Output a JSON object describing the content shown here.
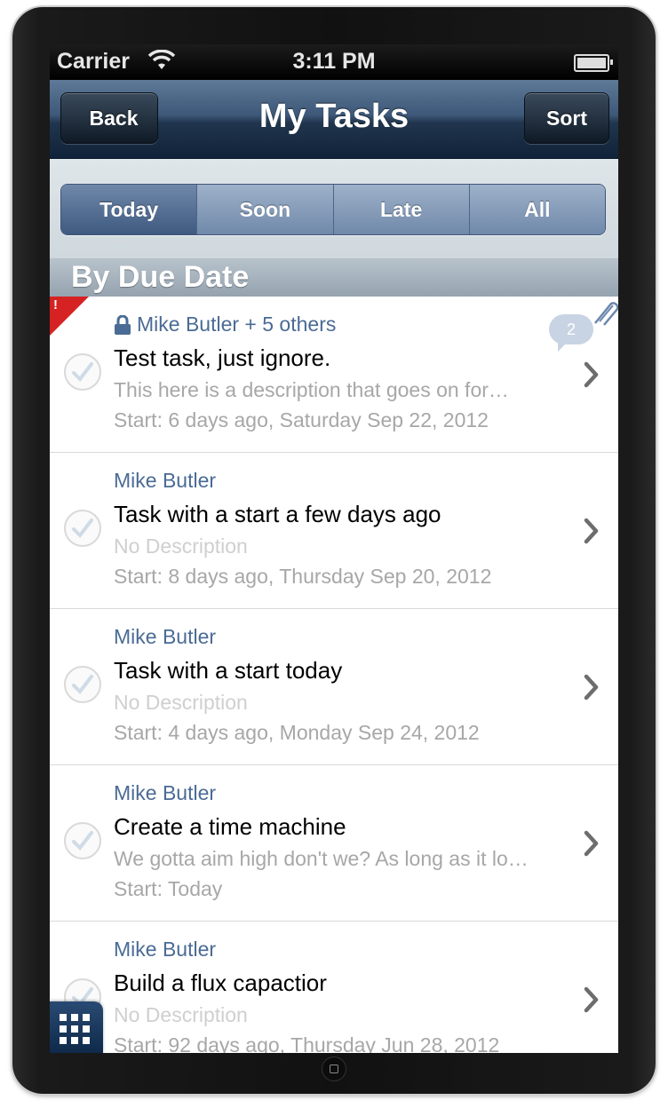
{
  "status_bar": {
    "carrier": "Carrier",
    "time": "3:11 PM"
  },
  "nav": {
    "back_label": "Back",
    "title": "My Tasks",
    "sort_label": "Sort"
  },
  "segments": [
    "Today",
    "Soon",
    "Late",
    "All"
  ],
  "selected_segment": "Today",
  "section_header": "By Due Date",
  "tasks": [
    {
      "owner": "Mike Butler + 5 others",
      "title": "Test task, just ignore.",
      "description": "This here is a description that goes on for…",
      "start": "Start: 6 days ago, Saturday Sep 22, 2012",
      "flag": "!",
      "comments": "2"
    },
    {
      "owner": "Mike Butler",
      "title": "Task with a start a few days ago",
      "description": "No Description",
      "start": "Start: 8 days ago, Thursday Sep 20, 2012"
    },
    {
      "owner": "Mike Butler",
      "title": "Task with a start today",
      "description": "No Description",
      "start": "Start: 4 days ago, Monday Sep 24, 2012"
    },
    {
      "owner": "Mike Butler",
      "title": "Create a time machine",
      "description": "We gotta aim high don't we?  As long as it lo…",
      "start": "Start: Today"
    },
    {
      "owner": "Mike Butler",
      "title": "Build a flux capactior",
      "description": "No Description",
      "start": "Start: 92 days ago, Thursday Jun 28, 2012"
    }
  ],
  "colors": {
    "nav_dark": "#0f2238",
    "segment_selected": "#3f5a80",
    "owner_text": "#4a6b95",
    "flag": "#d62222",
    "comment_bubble": "#c8d4e3"
  },
  "icons": [
    "wifi-icon",
    "battery-icon",
    "lock-icon",
    "checkmark-icon",
    "chevron-right-icon",
    "paperclip-icon",
    "comment-bubble-icon",
    "app-grid-icon",
    "home-button-icon"
  ]
}
